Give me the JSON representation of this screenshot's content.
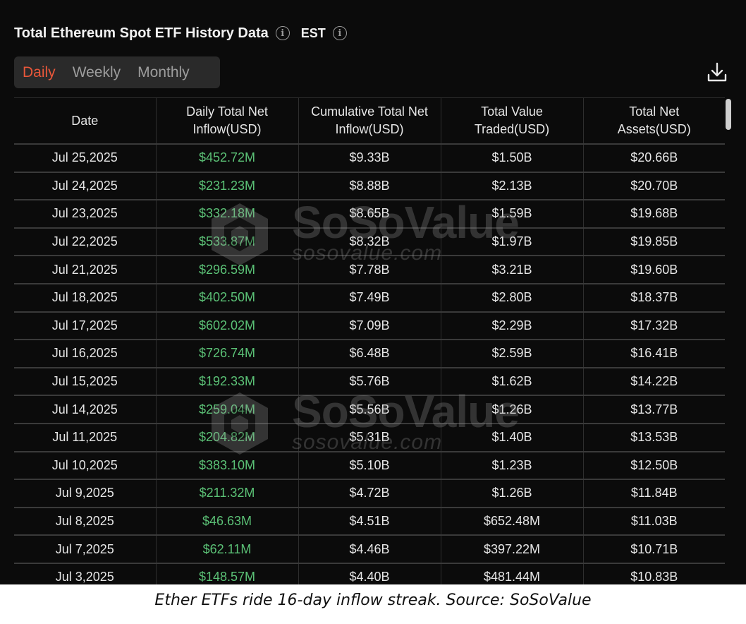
{
  "header": {
    "title": "Total Ethereum Spot ETF History Data",
    "timezone": "EST",
    "info_icon": "info-icon"
  },
  "tabs": [
    {
      "label": "Daily",
      "active": true
    },
    {
      "label": "Weekly",
      "active": false
    },
    {
      "label": "Monthly",
      "active": false
    }
  ],
  "download_icon": "download-icon",
  "table": {
    "columns": [
      [
        "Date"
      ],
      [
        "Daily Total Net",
        "Inflow(USD)"
      ],
      [
        "Cumulative Total Net",
        "Inflow(USD)"
      ],
      [
        "Total Value",
        "Traded(USD)"
      ],
      [
        "Total Net",
        "Assets(USD)"
      ]
    ],
    "rows": [
      [
        "Jul 25,2025",
        "$452.72M",
        "$9.33B",
        "$1.50B",
        "$20.66B"
      ],
      [
        "Jul 24,2025",
        "$231.23M",
        "$8.88B",
        "$2.13B",
        "$20.70B"
      ],
      [
        "Jul 23,2025",
        "$332.18M",
        "$8.65B",
        "$1.59B",
        "$19.68B"
      ],
      [
        "Jul 22,2025",
        "$533.87M",
        "$8.32B",
        "$1.97B",
        "$19.85B"
      ],
      [
        "Jul 21,2025",
        "$296.59M",
        "$7.78B",
        "$3.21B",
        "$19.60B"
      ],
      [
        "Jul 18,2025",
        "$402.50M",
        "$7.49B",
        "$2.80B",
        "$18.37B"
      ],
      [
        "Jul 17,2025",
        "$602.02M",
        "$7.09B",
        "$2.29B",
        "$17.32B"
      ],
      [
        "Jul 16,2025",
        "$726.74M",
        "$6.48B",
        "$2.59B",
        "$16.41B"
      ],
      [
        "Jul 15,2025",
        "$192.33M",
        "$5.76B",
        "$1.62B",
        "$14.22B"
      ],
      [
        "Jul 14,2025",
        "$259.04M",
        "$5.56B",
        "$1.26B",
        "$13.77B"
      ],
      [
        "Jul 11,2025",
        "$204.82M",
        "$5.31B",
        "$1.40B",
        "$13.53B"
      ],
      [
        "Jul 10,2025",
        "$383.10M",
        "$5.10B",
        "$1.23B",
        "$12.50B"
      ],
      [
        "Jul 9,2025",
        "$211.32M",
        "$4.72B",
        "$1.26B",
        "$11.84B"
      ],
      [
        "Jul 8,2025",
        "$46.63M",
        "$4.51B",
        "$652.48M",
        "$11.03B"
      ],
      [
        "Jul 7,2025",
        "$62.11M",
        "$4.46B",
        "$397.22M",
        "$10.71B"
      ],
      [
        "Jul 3,2025",
        "$148.57M",
        "$4.40B",
        "$481.44M",
        "$10.83B"
      ]
    ]
  },
  "watermark": {
    "brand": "SoSoValue",
    "domain": "sosovalue.com"
  },
  "caption": "Ether ETFs ride 16-day inflow streak. Source: SoSoValue",
  "colors": {
    "background": "#0b0b0b",
    "active_tab": "#e8573a",
    "positive": "#5bc176",
    "text": "#e6e6e6"
  }
}
